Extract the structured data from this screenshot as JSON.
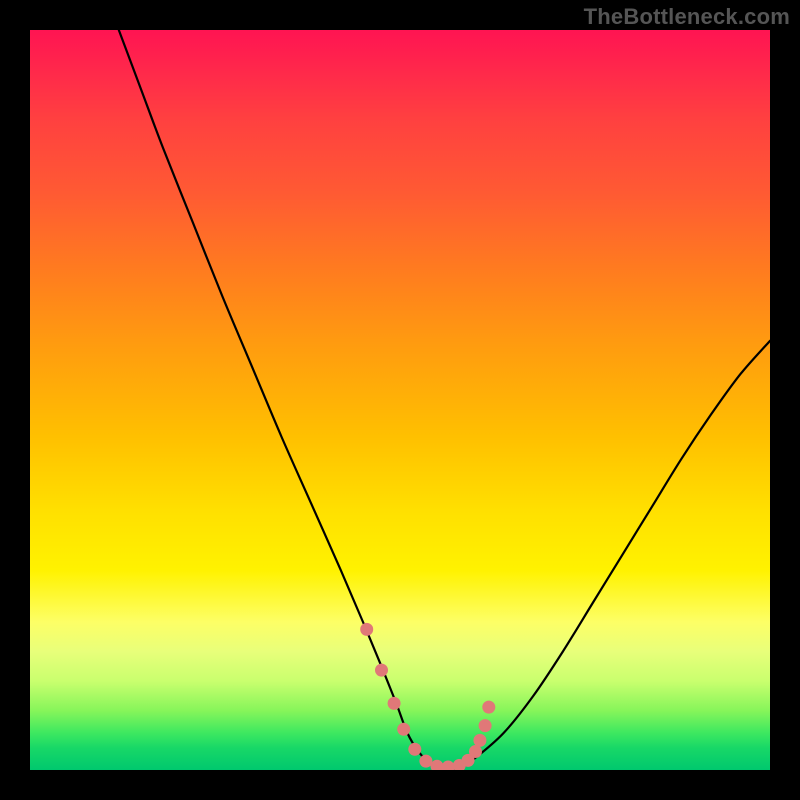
{
  "watermark": "TheBottleneck.com",
  "chart_data": {
    "type": "line",
    "title": "",
    "xlabel": "",
    "ylabel": "",
    "xlim": [
      0,
      100
    ],
    "ylim": [
      0,
      100
    ],
    "grid": false,
    "legend": false,
    "background_gradient_stops": [
      {
        "pos": 0,
        "color": "#ff1452"
      },
      {
        "pos": 12,
        "color": "#ff4040"
      },
      {
        "pos": 32,
        "color": "#ff7a20"
      },
      {
        "pos": 55,
        "color": "#ffc000"
      },
      {
        "pos": 73,
        "color": "#fff200"
      },
      {
        "pos": 88,
        "color": "#c9ff6e"
      },
      {
        "pos": 100,
        "color": "#00c86e"
      }
    ],
    "series": [
      {
        "name": "curve",
        "color": "#000000",
        "x": [
          12,
          15,
          18,
          22,
          26,
          30,
          34,
          38,
          42,
          45,
          47.5,
          49.5,
          51,
          52.5,
          54,
          56,
          58,
          60,
          64,
          68,
          72,
          76,
          80,
          84,
          88,
          92,
          96,
          100
        ],
        "y": [
          100,
          92,
          84,
          74,
          64,
          54.5,
          45,
          36,
          27,
          20,
          14,
          9,
          5,
          2.5,
          1,
          0.3,
          0.3,
          1.5,
          5,
          10,
          16,
          22.5,
          29,
          35.5,
          42,
          48,
          53.5,
          58
        ]
      },
      {
        "name": "highlight-dots",
        "type": "scatter",
        "color": "#e07878",
        "x": [
          45.5,
          47.5,
          49.2,
          50.5,
          52.0,
          53.5,
          55.0,
          56.5,
          58.0,
          59.2,
          60.2,
          60.8,
          61.5,
          62.0
        ],
        "y": [
          19.0,
          13.5,
          9.0,
          5.5,
          2.8,
          1.2,
          0.5,
          0.4,
          0.6,
          1.3,
          2.5,
          4.0,
          6.0,
          8.5
        ]
      }
    ],
    "annotations": []
  }
}
